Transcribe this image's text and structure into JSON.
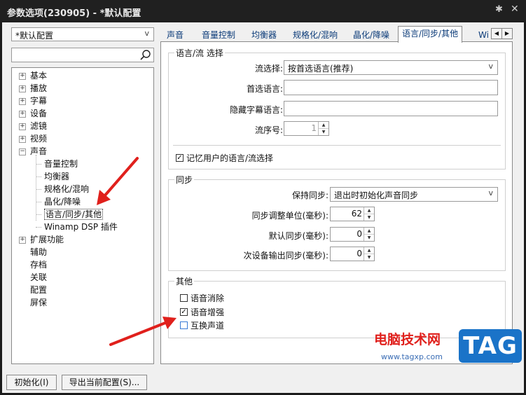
{
  "window": {
    "title": "参数选项(230905) - *默认配置",
    "pin_glyph": "✱",
    "close_glyph": "✕"
  },
  "left": {
    "profile_value": "*默认配置",
    "search_placeholder": "",
    "tree": [
      {
        "label": "基本",
        "expander": "+"
      },
      {
        "label": "播放",
        "expander": "+"
      },
      {
        "label": "字幕",
        "expander": "+"
      },
      {
        "label": "设备",
        "expander": "+"
      },
      {
        "label": "滤镜",
        "expander": "+"
      },
      {
        "label": "视频",
        "expander": "+"
      },
      {
        "label": "声音",
        "expander": "−"
      },
      {
        "label": "音量控制"
      },
      {
        "label": "均衡器"
      },
      {
        "label": "规格化/混响"
      },
      {
        "label": "晶化/降噪"
      },
      {
        "label": "语言/同步/其他"
      },
      {
        "label": "Winamp DSP 插件"
      },
      {
        "label": "扩展功能",
        "expander": "+"
      },
      {
        "label": "辅助"
      },
      {
        "label": "存档"
      },
      {
        "label": "关联"
      },
      {
        "label": "配置"
      },
      {
        "label": "屏保"
      }
    ]
  },
  "tabs": [
    "声音",
    "音量控制",
    "均衡器",
    "规格化/混响",
    "晶化/降噪",
    "语言/同步/其他",
    "Wi"
  ],
  "lang": {
    "group_title": "语言/流 选择",
    "stream_select_label": "流选择:",
    "stream_select_value": "按首选语言(推荐)",
    "preferred_lang_label": "首选语言:",
    "preferred_lang_value": "",
    "hidden_sub_label": "隐藏字幕语言:",
    "hidden_sub_value": "",
    "stream_no_label": "流序号:",
    "stream_no_value": "1",
    "remember_label": "记忆用户的语言/流选择",
    "remember_checked": true
  },
  "sync": {
    "group_title": "同步",
    "keep_sync_label": "保持同步:",
    "keep_sync_value": "退出时初始化声音同步",
    "adjust_unit_label": "同步调整单位(毫秒):",
    "adjust_unit_value": "62",
    "default_sync_label": "默认同步(毫秒):",
    "default_sync_value": "0",
    "secondary_sync_label": "次设备输出同步(毫秒):",
    "secondary_sync_value": "0"
  },
  "other": {
    "group_title": "其他",
    "items": [
      {
        "label": "语音消除",
        "checked": false
      },
      {
        "label": "语音增强",
        "checked": true
      },
      {
        "label": "互换声道",
        "checked": false
      }
    ]
  },
  "buttons": {
    "init": "初始化(I)",
    "export": "导出当前配置(S)..."
  },
  "watermark": {
    "line1": "电脑技术网",
    "line2": "www.tagxp.com",
    "tag": "TAG"
  },
  "colors": {
    "arrow": "#e0201c",
    "link_text": "#0a3a78",
    "tag_bg": "#1a73c8"
  }
}
